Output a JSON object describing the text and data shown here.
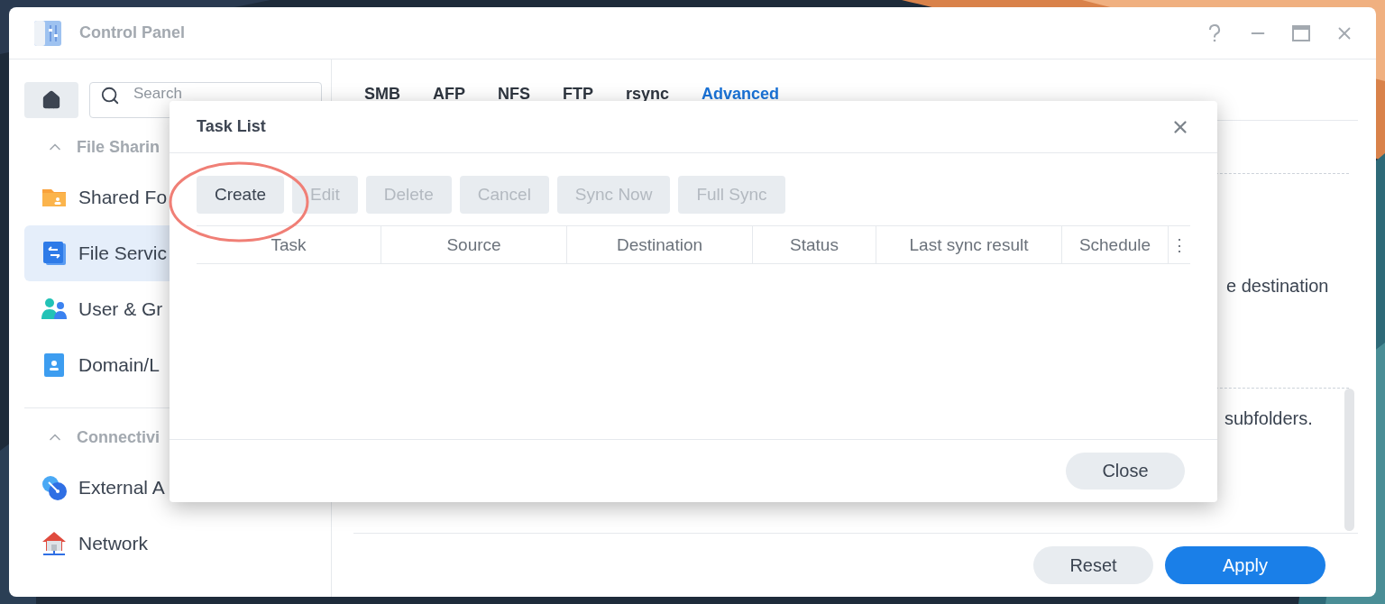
{
  "window": {
    "title": "Control Panel"
  },
  "sidebar": {
    "search": {
      "placeholder": "Search"
    },
    "sections": [
      {
        "label": "File Sharin",
        "expanded": true,
        "items": [
          {
            "label": "Shared Fo",
            "kind": "folder",
            "selected": false
          },
          {
            "label": "File Servic",
            "kind": "transfer",
            "selected": true
          },
          {
            "label": "User & Gr",
            "kind": "users",
            "selected": false
          },
          {
            "label": "Domain/L",
            "kind": "directory",
            "selected": false
          }
        ]
      },
      {
        "label": "Connectivi",
        "expanded": true,
        "items": [
          {
            "label": "External A",
            "kind": "link",
            "selected": false
          },
          {
            "label": "Network",
            "kind": "house",
            "selected": false
          }
        ]
      }
    ]
  },
  "tabs": [
    {
      "label": "SMB",
      "selected": false
    },
    {
      "label": "AFP",
      "selected": false
    },
    {
      "label": "NFS",
      "selected": false
    },
    {
      "label": "FTP",
      "selected": false
    },
    {
      "label": "rsync",
      "selected": false
    },
    {
      "label": "Advanced",
      "selected": true
    }
  ],
  "content_fragments": [
    "e destination",
    "subfolders."
  ],
  "footer_buttons": [
    {
      "label": "Reset",
      "kind": "secondary"
    },
    {
      "label": "Apply",
      "kind": "primary"
    }
  ],
  "dialog": {
    "title": "Task List",
    "toolbar": [
      {
        "label": "Create",
        "disabled": false
      },
      {
        "label": "Edit",
        "disabled": true
      },
      {
        "label": "Delete",
        "disabled": true
      },
      {
        "label": "Cancel",
        "disabled": true
      },
      {
        "label": "Sync Now",
        "disabled": true
      },
      {
        "label": "Full Sync",
        "disabled": true
      }
    ],
    "columns": [
      "Task",
      "Source",
      "Destination",
      "Status",
      "Last sync result",
      "Schedule"
    ],
    "column_menu": "⋮",
    "close_button": "Close"
  }
}
